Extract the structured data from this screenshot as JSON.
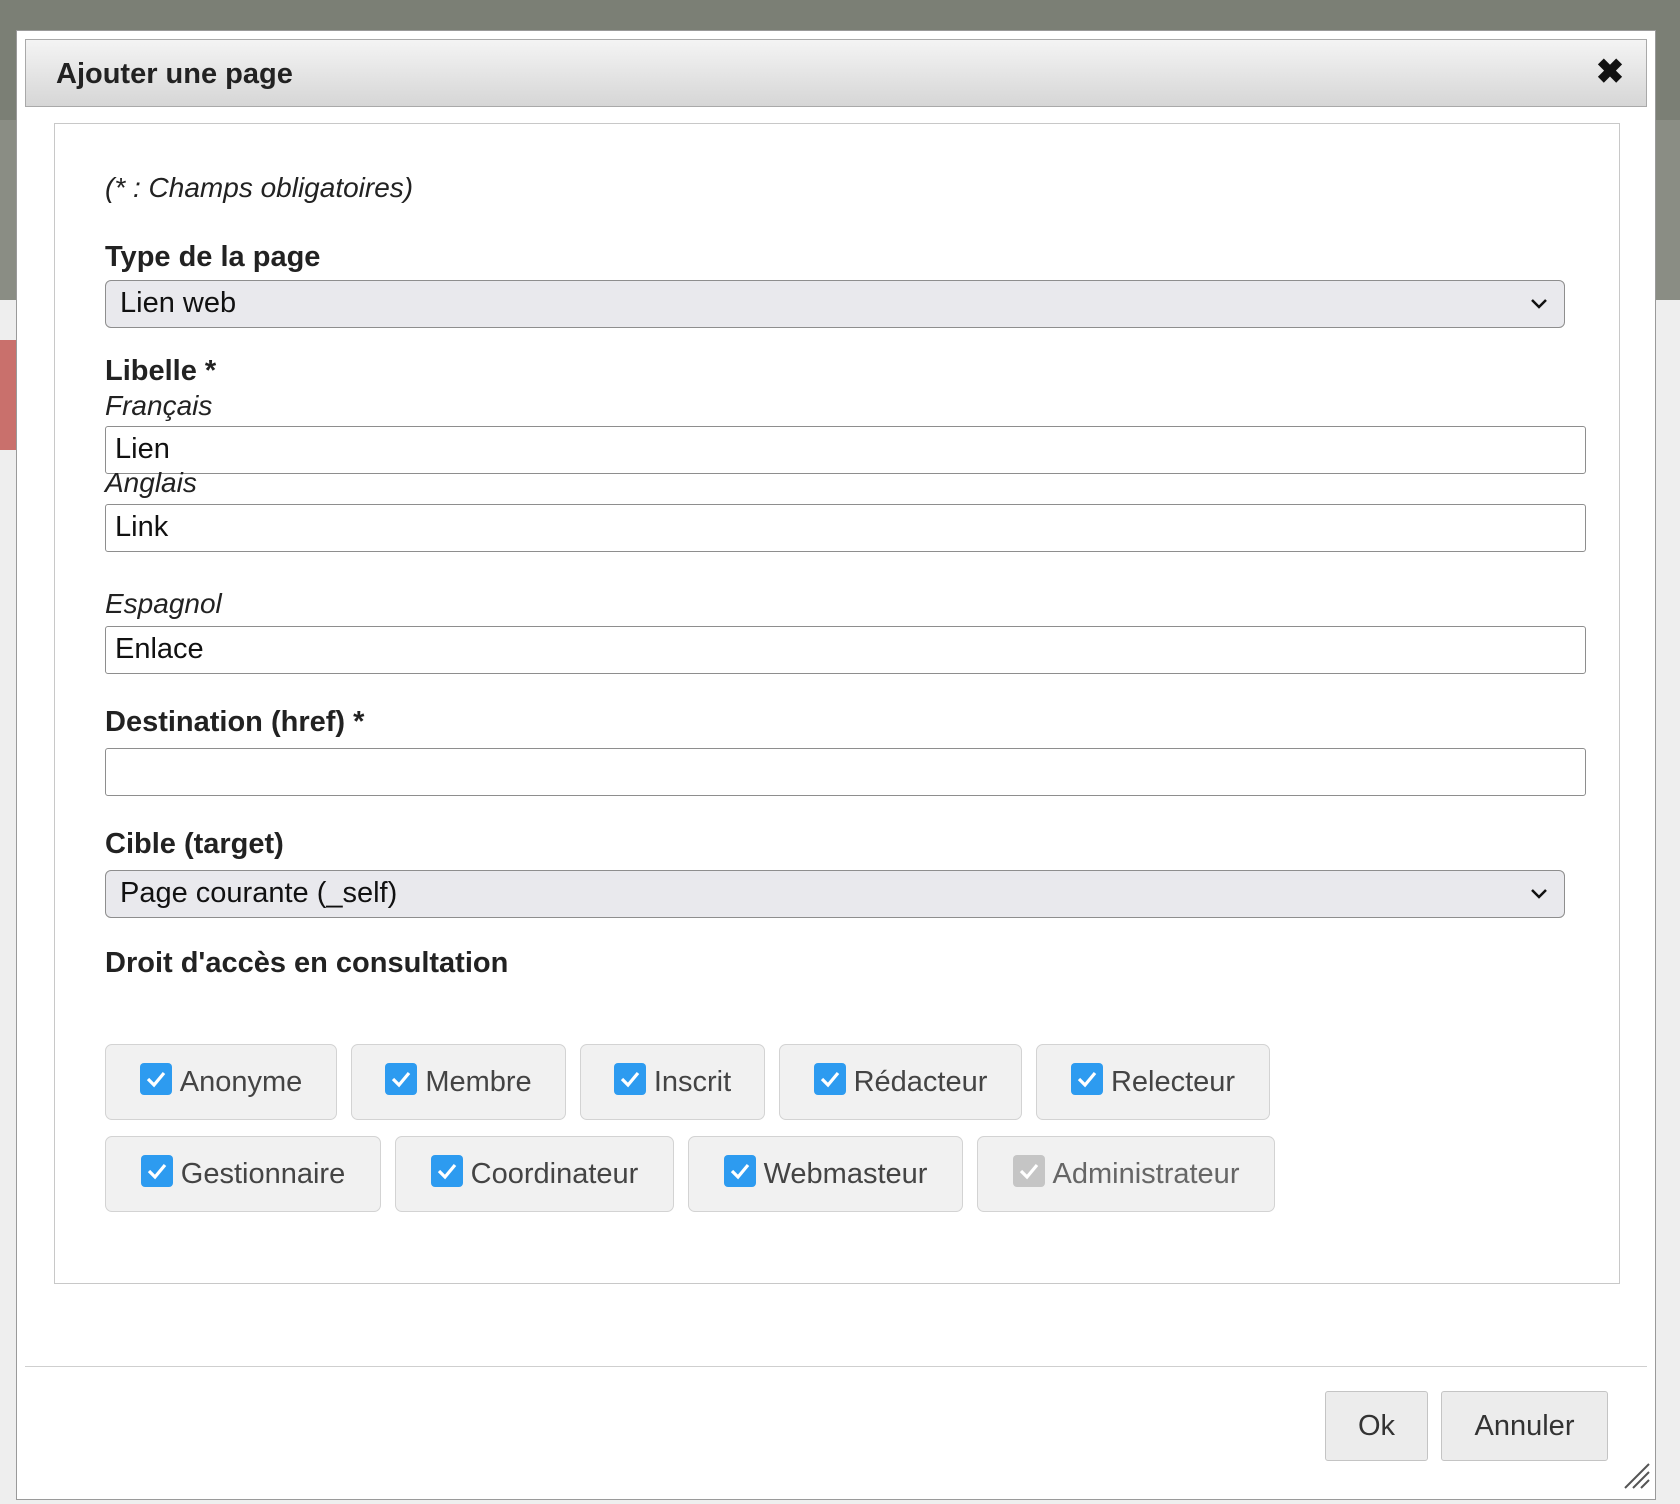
{
  "dialog": {
    "title": "Ajouter une page",
    "close_icon": "close-icon"
  },
  "form": {
    "required_note": "(* : Champs obligatoires)",
    "page_type": {
      "label": "Type de la page",
      "value": "Lien web"
    },
    "libelle": {
      "label": "Libelle *",
      "french": {
        "label": "Français",
        "value": "Lien"
      },
      "english": {
        "label": "Anglais",
        "value": "Link"
      },
      "spanish": {
        "label": "Espagnol",
        "value": "Enlace"
      }
    },
    "destination": {
      "label": "Destination (href) *",
      "value": ""
    },
    "target": {
      "label": "Cible (target)",
      "value": "Page courante (_self)"
    },
    "access": {
      "label": "Droit d'accès en consultation",
      "options": [
        {
          "label": "Anonyme",
          "checked": true,
          "disabled": false
        },
        {
          "label": "Membre",
          "checked": true,
          "disabled": false
        },
        {
          "label": "Inscrit",
          "checked": true,
          "disabled": false
        },
        {
          "label": "Rédacteur",
          "checked": true,
          "disabled": false
        },
        {
          "label": "Relecteur",
          "checked": true,
          "disabled": false
        },
        {
          "label": "Gestionnaire",
          "checked": true,
          "disabled": false
        },
        {
          "label": "Coordinateur",
          "checked": true,
          "disabled": false
        },
        {
          "label": "Webmasteur",
          "checked": true,
          "disabled": false
        },
        {
          "label": "Administrateur",
          "checked": true,
          "disabled": true
        }
      ]
    }
  },
  "buttons": {
    "ok": "Ok",
    "cancel": "Annuler"
  },
  "colors": {
    "checkbox_accent": "#2d9bf0",
    "checkbox_disabled": "#c5c5c5"
  }
}
